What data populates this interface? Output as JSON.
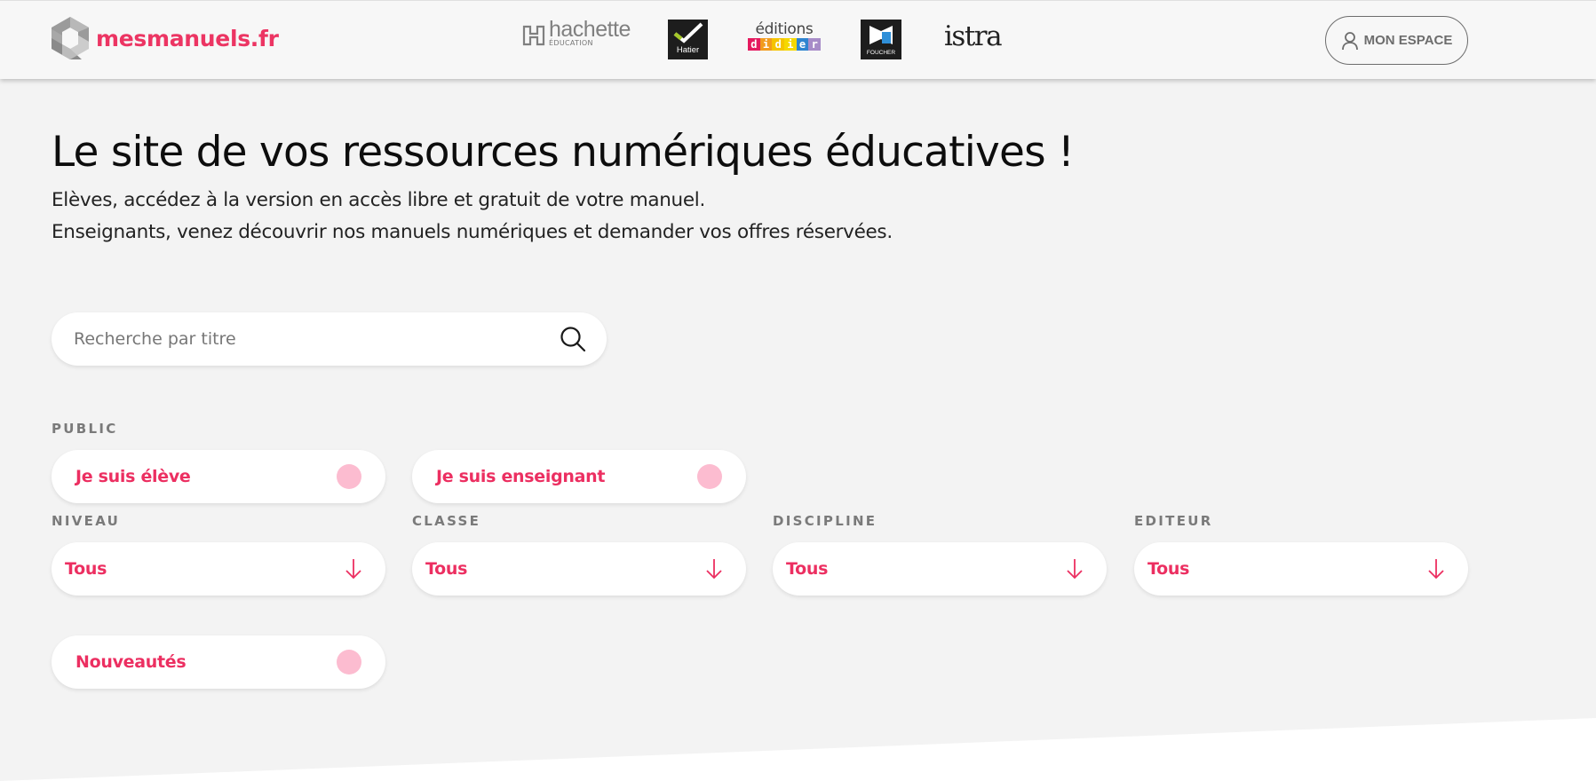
{
  "header": {
    "brand": "mesmanuels.fr",
    "partners": {
      "hachette": {
        "name": "hachette",
        "sub": "ÉDUCATION"
      },
      "hatier": {
        "name": "Hatier"
      },
      "didier": {
        "top": "éditions",
        "letters": [
          "d",
          "i",
          "d",
          "i",
          "e",
          "r"
        ],
        "colors": [
          "#e5195e",
          "#f29b1d",
          "#f5c400",
          "#f5d800",
          "#2f84d0",
          "#a78cc8"
        ]
      },
      "foucher": {
        "name": "FOUCHER"
      },
      "istra": {
        "name": "istra"
      }
    },
    "account_button": {
      "label": "MON ESPACE",
      "icon": "user-icon"
    }
  },
  "hero": {
    "title": "Le site de vos ressources numériques éducatives !",
    "subtitle_1": "Elèves, accédez à la version en accès libre et gratuit de votre manuel.",
    "subtitle_2": "Enseignants, venez découvrir nos manuels numériques et demander vos offres réservées."
  },
  "search": {
    "placeholder": "Recherche par titre",
    "value": "",
    "icon": "search-icon"
  },
  "filters": {
    "public": {
      "label": "PUBLIC",
      "options": [
        {
          "label": "Je suis élève",
          "checked": false
        },
        {
          "label": "Je suis enseignant",
          "checked": false
        }
      ]
    },
    "selects": [
      {
        "label": "NIVEAU",
        "value": "Tous"
      },
      {
        "label": "CLASSE",
        "value": "Tous"
      },
      {
        "label": "DISCIPLINE",
        "value": "Tous"
      },
      {
        "label": "EDITEUR",
        "value": "Tous"
      }
    ],
    "new_releases": {
      "label": "Nouveautés",
      "checked": false
    }
  },
  "colors": {
    "accent": "#ec2f61",
    "toggle_off": "#fcbcd0",
    "background": "#f3f3f3",
    "header_bg": "#f7f7f7"
  }
}
